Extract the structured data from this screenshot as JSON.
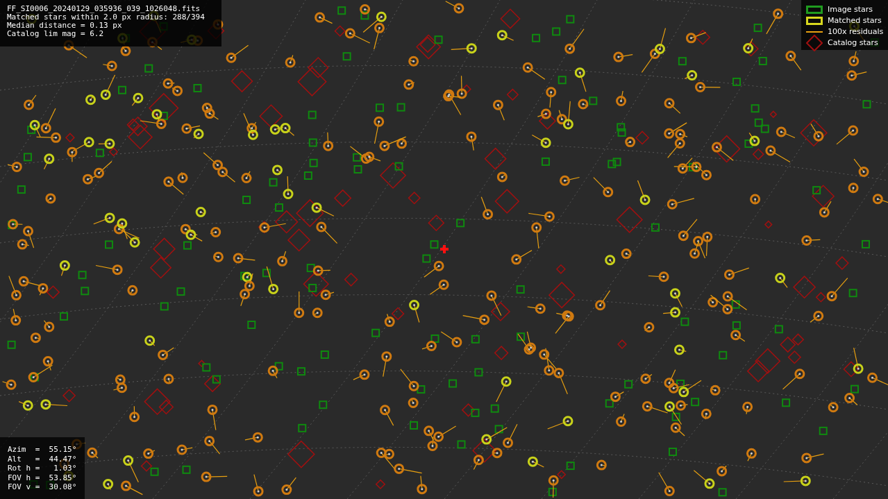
{
  "info": {
    "lines": [
      "FF_SI0006_20240129_035936_039_1026048.fits",
      "Matched stars within 2.0 px radius: 288/394",
      "Median distance = 0.13 px",
      "Catalog lim mag = 6.2"
    ]
  },
  "legend": [
    {
      "kind": "image",
      "label": "Image stars"
    },
    {
      "kind": "matched",
      "label": "Matched stars"
    },
    {
      "kind": "residual",
      "label": "100x residuals"
    },
    {
      "kind": "catalog",
      "label": "Catalog stars"
    }
  ],
  "pointing": [
    "Azim  =  55.15°",
    "Alt   =  44.47°",
    "Rot h =   1.03°",
    "FOV h =  53.85°",
    "FOV v =  30.08°"
  ]
}
